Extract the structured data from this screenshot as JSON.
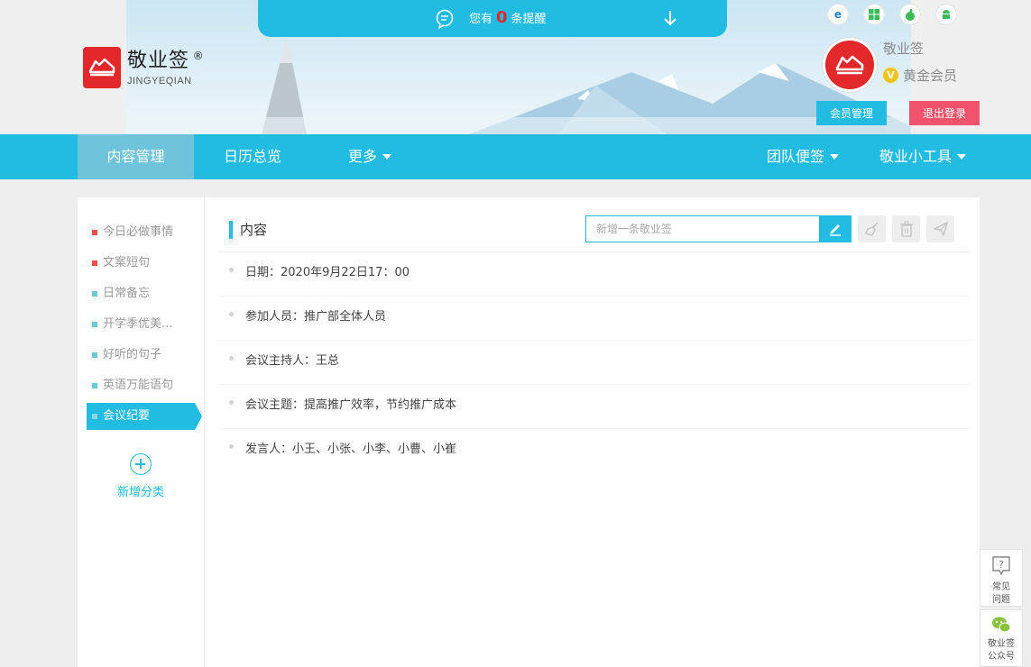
{
  "brand": {
    "name_cn": "敬业签",
    "reg": "®",
    "name_en": "JINGYEQIAN"
  },
  "reminder": {
    "prefix": "您有",
    "count": "0",
    "suffix": "条提醒"
  },
  "platforms": [
    "ie-icon",
    "windows-icon",
    "apple-icon",
    "android-icon"
  ],
  "user": {
    "name": "敬业签",
    "level": "黄金会员",
    "vip_badge": "V"
  },
  "buttons": {
    "member": "会员管理",
    "logout": "退出登录"
  },
  "nav": {
    "left": [
      "内容管理",
      "日历总览",
      "更多"
    ],
    "right": [
      "团队便签",
      "敬业小工具"
    ]
  },
  "categories": [
    {
      "label": "今日必做事情",
      "color": "#e9534a"
    },
    {
      "label": "文案短句",
      "color": "#e9534a"
    },
    {
      "label": "日常备忘",
      "color": "#6cc7d6"
    },
    {
      "label": "开学季优美...",
      "color": "#6cc7d6"
    },
    {
      "label": "好听的句子",
      "color": "#6cc7d6"
    },
    {
      "label": "英语万能语句",
      "color": "#6cc7d6"
    },
    {
      "label": "会议纪要",
      "color": "#8bd3e8"
    }
  ],
  "add_category": "新增分类",
  "content": {
    "title": "内容",
    "placeholder": "新增一条敬业签",
    "items": [
      "日期：2020年9月22日17：00",
      "参加人员：推广部全体人员",
      "会议主持人：王总",
      "会议主题：提高推广效率，节约推广成本",
      "发言人：小王、小张、小李、小曹、小崔"
    ]
  },
  "float": {
    "faq": "常见\n问题",
    "wechat": "敬业签\n公众号"
  },
  "colors": {
    "accent": "#22bbe2",
    "logout": "#f0536b",
    "brand_red": "#e3282c"
  }
}
